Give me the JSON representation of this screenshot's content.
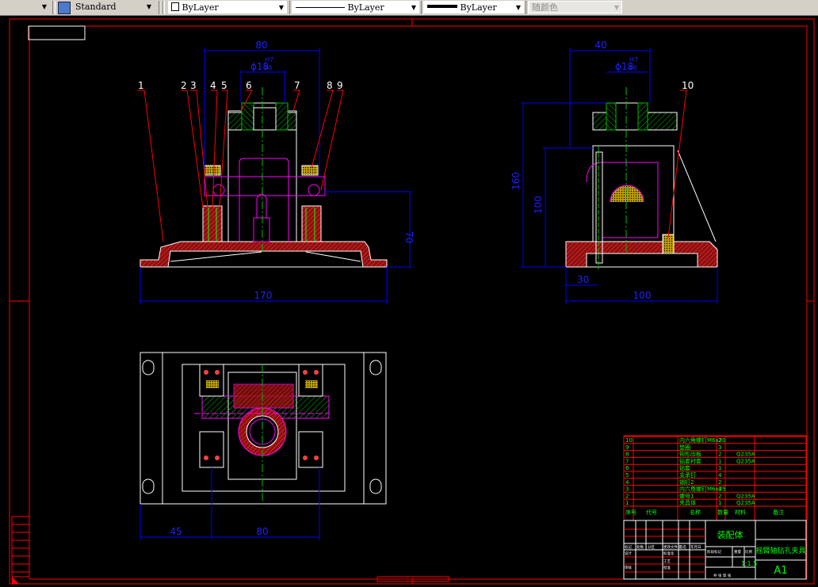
{
  "toolbar": {
    "text_style": "Standard",
    "color": "ByLayer",
    "linetype": "ByLayer",
    "lineweight": "ByLayer",
    "plot_style": "随颜色"
  },
  "front_view": {
    "dims": {
      "width_top": "80",
      "bore": "ϕ18",
      "fit_upper": "H7",
      "fit_lower": "k6",
      "height": "70",
      "width_base": "170"
    },
    "balloons": [
      "1",
      "2",
      "3",
      "4",
      "5",
      "6",
      "7",
      "8",
      "9"
    ]
  },
  "side_view": {
    "dims": {
      "width_top": "40",
      "bore": "ϕ18",
      "fit_upper": "H7",
      "fit_lower": "k6",
      "height_total": "160",
      "height_axis": "100",
      "offset": "30",
      "width_base": "100"
    },
    "balloons": [
      "10"
    ]
  },
  "top_view": {
    "dims": {
      "left": "45",
      "span": "80"
    }
  },
  "bom": {
    "rows": [
      {
        "no": "10",
        "name": "内六角螺钉M6x20",
        "qty": "2",
        "material": ""
      },
      {
        "no": "9",
        "name": "垫圈",
        "qty": "3",
        "material": ""
      },
      {
        "no": "8",
        "name": "钩形压板",
        "qty": "2",
        "material": "Q235A"
      },
      {
        "no": "7",
        "name": "钻套衬套",
        "qty": "1",
        "material": "Q235A"
      },
      {
        "no": "6",
        "name": "钻套",
        "qty": "1",
        "material": ""
      },
      {
        "no": "5",
        "name": "支承钉",
        "qty": "4",
        "material": ""
      },
      {
        "no": "4",
        "name": "销钉2",
        "qty": "2",
        "material": ""
      },
      {
        "no": "3",
        "name": "内六角螺钉M6x25",
        "qty": "4",
        "material": ""
      },
      {
        "no": "2",
        "name": "螺母1",
        "qty": "2",
        "material": "Q235A"
      },
      {
        "no": "1",
        "name": "夹具体",
        "qty": "1",
        "material": "Q235A"
      }
    ],
    "headers": {
      "no": "序号",
      "code": "代号",
      "name": "名称",
      "qty": "数量",
      "material": "材料",
      "remark": "备注"
    }
  },
  "title_block": {
    "part_name": "装配体",
    "drawing_title": "摇臂轴钻孔夹具",
    "scale": "1:1.5",
    "sheet_size": "A1",
    "labels": {
      "mark": "标记",
      "count": "处数",
      "zone": "分区",
      "change": "更改文件号",
      "sign": "签名",
      "date": "年月日",
      "design": "设计",
      "std": "标准化",
      "check": "审核",
      "process": "工艺",
      "approve": "批准",
      "stage": "阶段标记",
      "weight": "重量",
      "ratio": "比例",
      "sheets": "共 张 第 张"
    }
  },
  "colors": {
    "frame": "#ff0000",
    "dim": "#0000ff",
    "part": "#ff00ff",
    "hatch_green": "#00c000",
    "text": "#00ff00"
  }
}
